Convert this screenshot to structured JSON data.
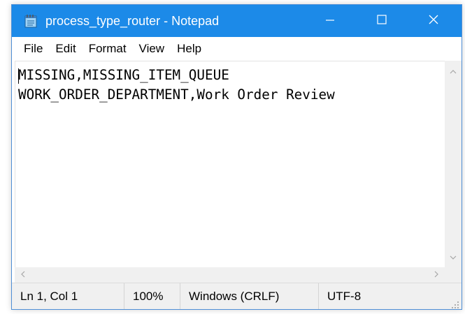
{
  "window": {
    "title": "process_type_router - Notepad",
    "accent_color": "#1c8ae8",
    "app_icon": "notepad-icon",
    "controls": [
      "minimize-icon",
      "maximize-icon",
      "close-icon"
    ]
  },
  "menu": {
    "items": [
      "File",
      "Edit",
      "Format",
      "View",
      "Help"
    ]
  },
  "editor": {
    "lines": [
      "MISSING,MISSING_ITEM_QUEUE",
      "WORK_ORDER_DEPARTMENT,Work Order Review"
    ]
  },
  "status": {
    "position": "Ln 1, Col 1",
    "zoom": "100%",
    "line_ending": "Windows (CRLF)",
    "encoding": "UTF-8"
  }
}
